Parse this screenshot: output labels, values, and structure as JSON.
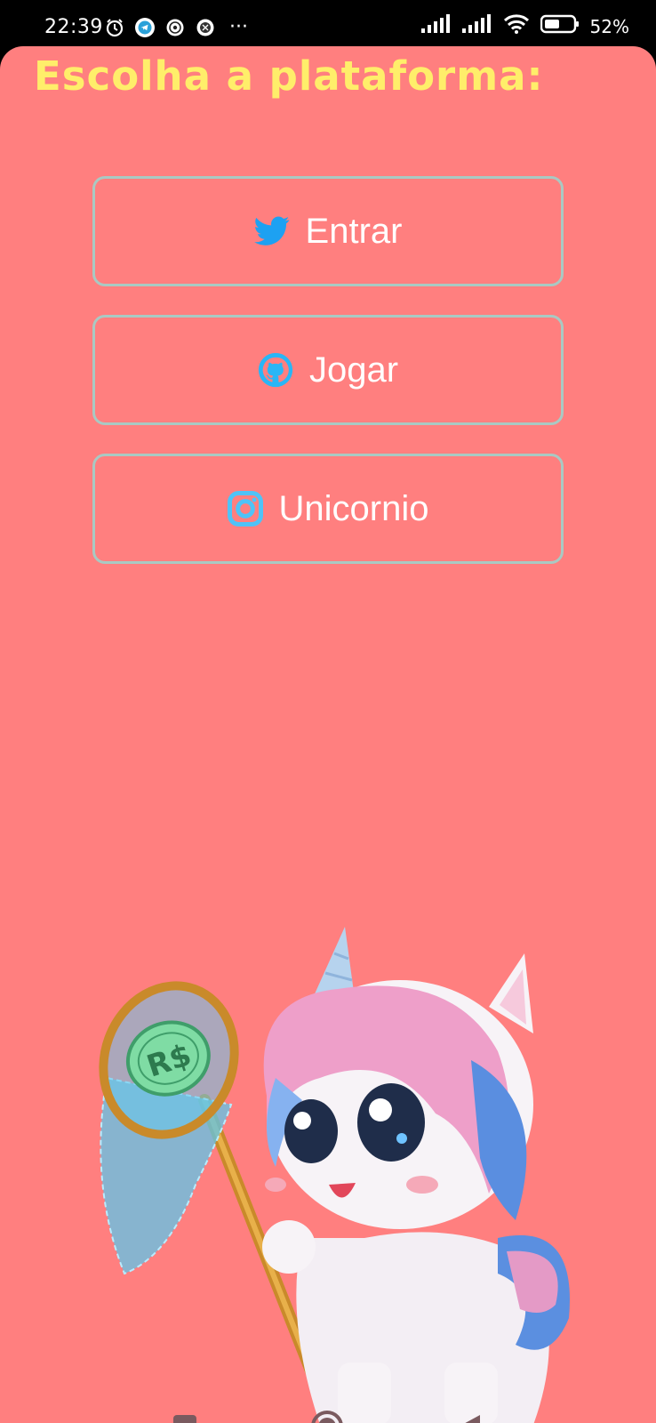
{
  "status_bar": {
    "time": "22:39",
    "battery": "52%",
    "more": "···",
    "icons": [
      "alarm-icon",
      "telegram-icon",
      "whatsapp-icon",
      "browser-icon",
      "signal-icon",
      "signal-icon",
      "wifi-icon",
      "battery-icon"
    ]
  },
  "title": "Escolha a plataforma:",
  "buttons": [
    {
      "label": "Entrar",
      "icon": "twitter-icon",
      "icon_color": "#1da1f2"
    },
    {
      "label": "Jogar",
      "icon": "github-icon",
      "icon_color": "#29b6f6"
    },
    {
      "label": "Unicornio",
      "icon": "instagram-icon",
      "icon_color": "#4fc3f7"
    }
  ],
  "illustration": {
    "coin_text": "R$"
  },
  "colors": {
    "background": "#ff7f7f",
    "title": "#ffee6a",
    "button_border": "#a9c9c3",
    "button_text": "#ffffff"
  },
  "nav": [
    "recent-apps-icon",
    "home-icon",
    "back-icon"
  ]
}
